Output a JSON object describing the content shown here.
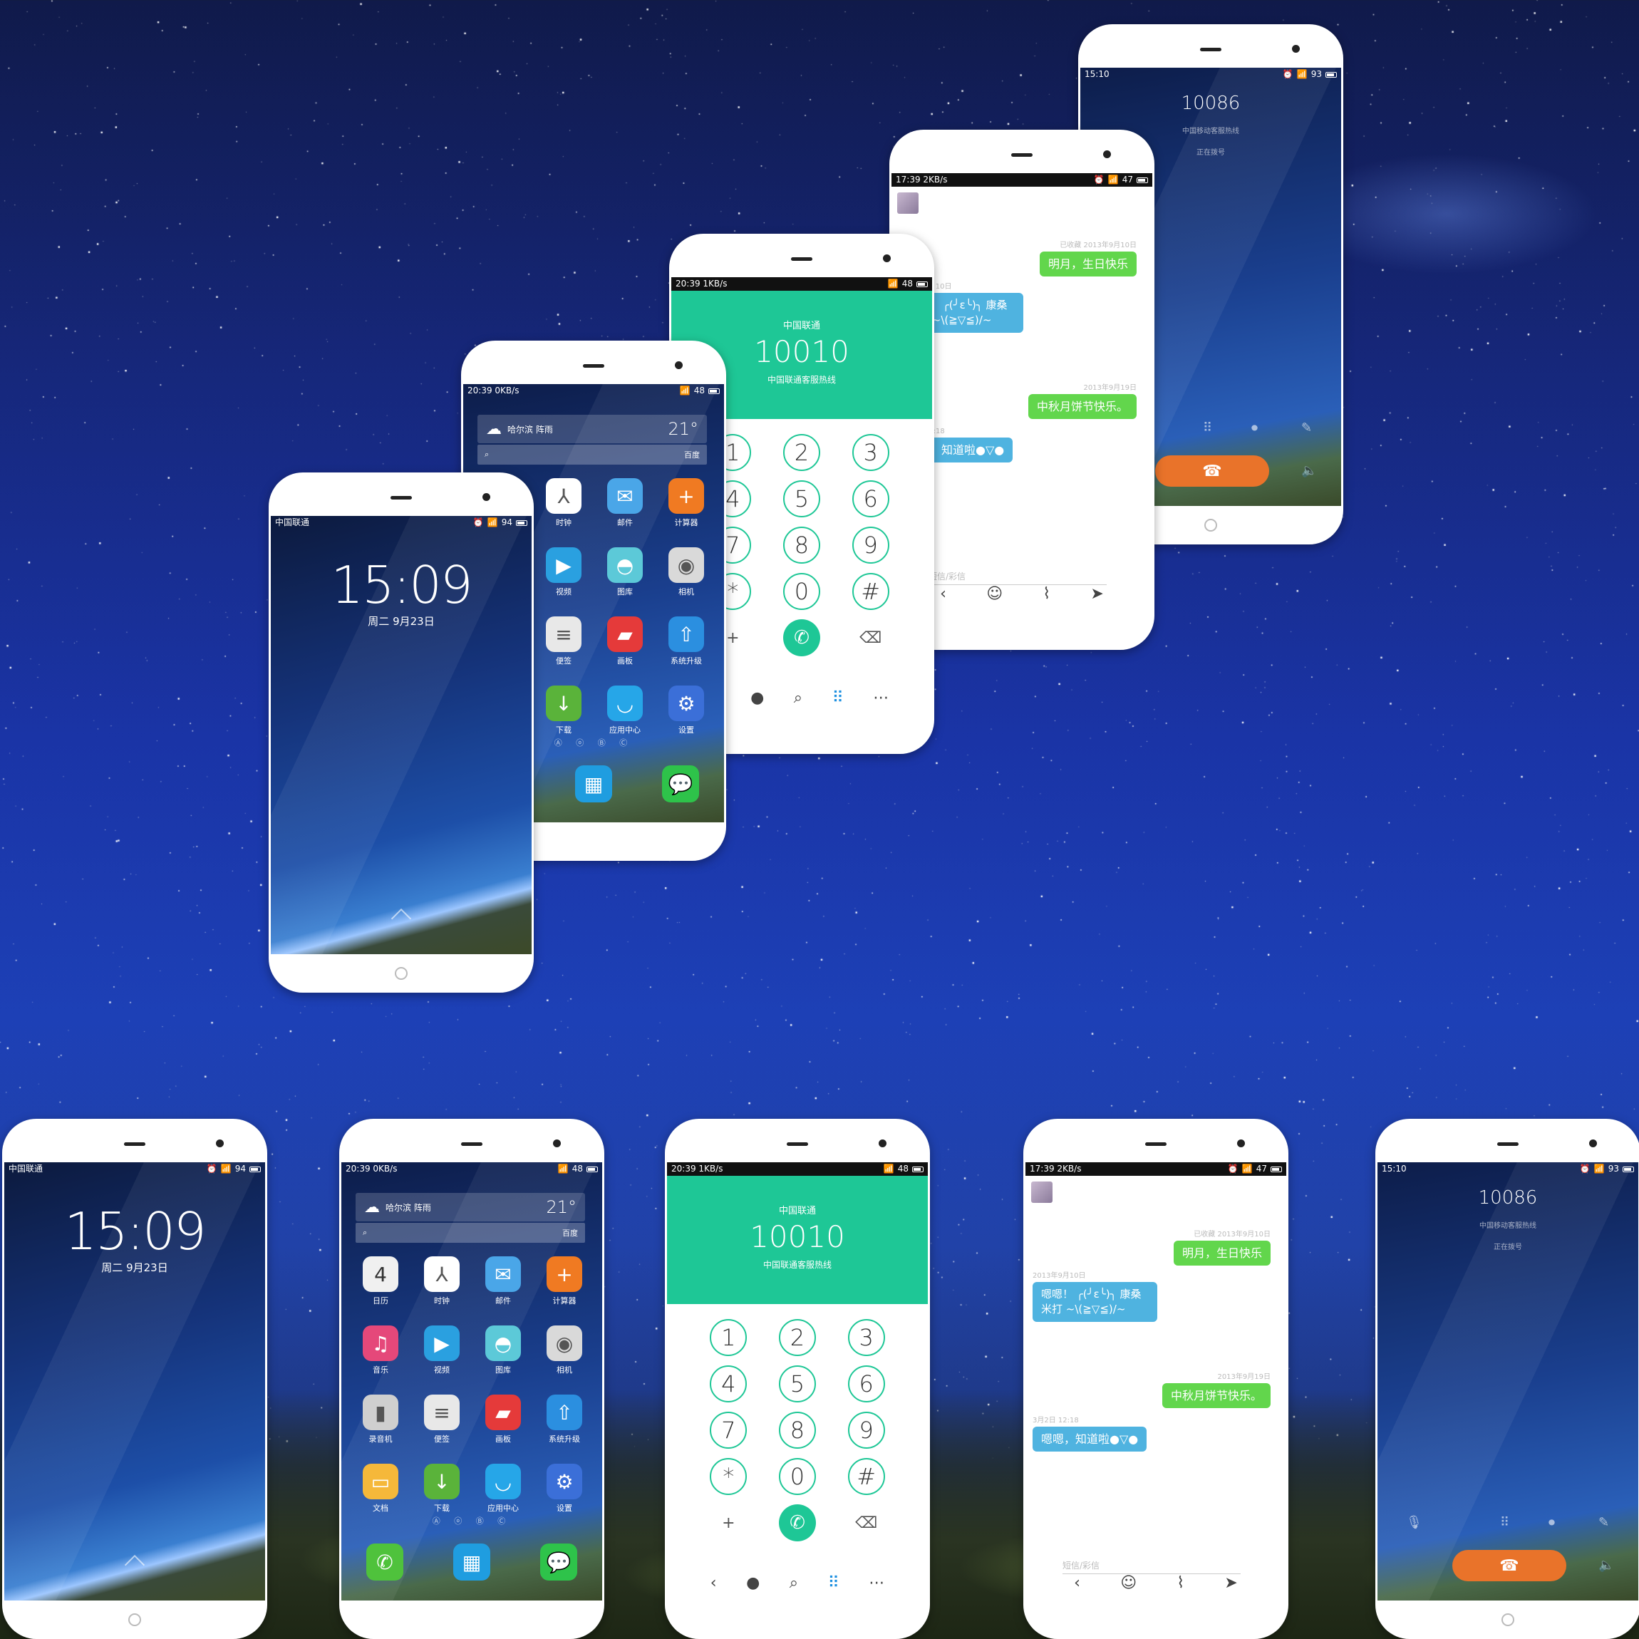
{
  "lockscreen": {
    "carrier": "中国联通",
    "battery": "94",
    "time": "15:09",
    "date": "周二 9月23日"
  },
  "home": {
    "clock": "20:39",
    "speed": "0KB/s",
    "battery": "48",
    "city": "哈尔滨 阵雨",
    "temp": "21°",
    "search_hint": "百度",
    "apps": [
      {
        "label": "日历",
        "icon": "calendar-icon",
        "badge": "4",
        "color": "#f0f0f0"
      },
      {
        "label": "时钟",
        "icon": "clock-icon",
        "color": "#ffffff"
      },
      {
        "label": "邮件",
        "icon": "mail-icon",
        "color": "#4aa6e8"
      },
      {
        "label": "计算器",
        "icon": "calculator-icon",
        "color": "#f07a22"
      },
      {
        "label": "音乐",
        "icon": "music-icon",
        "color": "#e5487a"
      },
      {
        "label": "视频",
        "icon": "video-icon",
        "color": "#2aa0e0"
      },
      {
        "label": "图库",
        "icon": "gallery-icon",
        "color": "#5cc9d8"
      },
      {
        "label": "相机",
        "icon": "camera-icon",
        "color": "#d9d9d9"
      },
      {
        "label": "录音机",
        "icon": "recorder-icon",
        "color": "#cfcfcf"
      },
      {
        "label": "便签",
        "icon": "notes-icon",
        "color": "#e8e8e8"
      },
      {
        "label": "画板",
        "icon": "paint-icon",
        "color": "#e53a3a"
      },
      {
        "label": "系统升级",
        "icon": "upgrade-icon",
        "color": "#2b8fe0"
      },
      {
        "label": "文档",
        "icon": "documents-icon",
        "color": "#f5b83a"
      },
      {
        "label": "下载",
        "icon": "download-icon",
        "color": "#5ab33a"
      },
      {
        "label": "应用中心",
        "icon": "app-center-icon",
        "color": "#26a6e8"
      },
      {
        "label": "设置",
        "icon": "settings-icon",
        "color": "#3b6fd8"
      }
    ],
    "page_dots": "Ⓐ ⓞ Ⓑ Ⓒ",
    "dock": [
      {
        "icon": "phone-icon",
        "color": "#4fc23c"
      },
      {
        "icon": "store-icon",
        "color": "#1f9de0"
      },
      {
        "icon": "chat-icon",
        "color": "#2ec34a"
      }
    ]
  },
  "dialer": {
    "clock": "20:39",
    "speed": "1KB/s",
    "battery": "48",
    "carrier": "中国联通",
    "number": "10010",
    "subtitle": "中国联通客服热线",
    "keys": [
      "1",
      "2",
      "3",
      "4",
      "5",
      "6",
      "7",
      "8",
      "9",
      "*",
      "0",
      "#"
    ],
    "add_contact": "+",
    "call": "✆",
    "backspace": "⌫",
    "nav": [
      "‹",
      "●",
      "⌕",
      "⠿",
      "⋯"
    ],
    "accent": "#1ec796"
  },
  "messages": {
    "clock": "17:39",
    "speed": "2KB/s",
    "battery": "47",
    "items": [
      {
        "meta": "已收藏 2013年9月10日",
        "text": "明月，生日快乐",
        "side": "right"
      },
      {
        "meta": "2013年9月10日",
        "text": "嗯嗯！ ╭(╯ε╰)╮ 康桑米打 ~\\(≧▽≦)/~",
        "side": "left"
      },
      {
        "meta": "2013年9月19日",
        "text": "中秋月饼节快乐。",
        "side": "right"
      },
      {
        "meta": "3月2日 12:18",
        "text": "嗯嗯，知道啦●▽●",
        "side": "left"
      }
    ],
    "input_placeholder": "短信/彩信",
    "toolbar": [
      "‹",
      "☺",
      "⌇",
      "➤"
    ]
  },
  "call": {
    "clock": "15:10",
    "battery": "93",
    "number": "10086",
    "subtitle": "中国移动客服热线",
    "status": "正在拨号",
    "hangup": "☎"
  }
}
